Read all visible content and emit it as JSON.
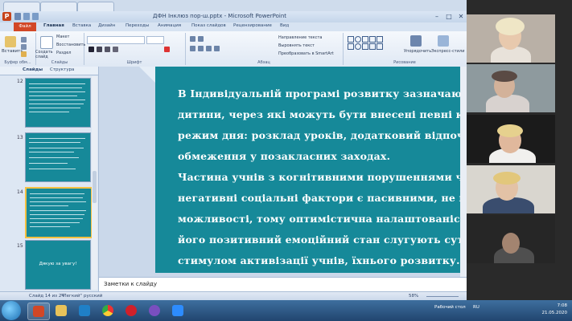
{
  "window": {
    "title": "ДФН Інклюз пор-ш.pptx - Microsoft PowerPoint",
    "app_badge": "P"
  },
  "ribbon": {
    "file_tab": "Файл",
    "tabs": [
      "Главная",
      "Вставка",
      "Дизайн",
      "Переходы",
      "Анимация",
      "Показ слайдов",
      "Рецензирование",
      "Вид"
    ],
    "clipboard": {
      "paste": "Вставить",
      "cut": "Вырезать",
      "copy": "Копировать",
      "format": "Формат по образцу",
      "label": "Буфер обм..."
    },
    "slides": {
      "create": "Создать слайд",
      "layout": "Макет",
      "reset": "Восстановить",
      "section": "Раздел",
      "label": "Слайды"
    },
    "font": {
      "label": "Шрифт"
    },
    "paragraph": {
      "direction": "Направление текста",
      "align": "Выровнять текст",
      "smartart": "Преобразовать в SmartArt",
      "label": "Абзац"
    },
    "drawing": {
      "arrange": "Упорядочить",
      "quick_styles": "Экспресс-стили",
      "label": "Рисование"
    }
  },
  "left_pane": {
    "tabs": [
      "Слайды",
      "Структура"
    ],
    "slides": [
      {
        "number": "12"
      },
      {
        "number": "13"
      },
      {
        "number": "14",
        "selected": true
      },
      {
        "number": "15",
        "text": "Дякую за увагу!"
      }
    ]
  },
  "slide": {
    "lines": [
      "В Індивідуальній програмі розвитку зазначаються потр",
      "дитини, через які можуть бути внесені певні коректи",
      "режим дня: розклад уроків, додатковий відпочи",
      "обмеження у позакласних заходах.",
      "Частина учнів з когнітивними порушеннями ч",
      "негативні соціальні фактори є пасивними, не вірять у",
      "можливості, тому оптимістична налаштованість педа",
      "його позитивний емоційний стан слугують сутте",
      "стимулом активізації учнів, їхнього розвитку."
    ]
  },
  "notes": {
    "placeholder": "Заметки к слайду"
  },
  "status_bar": {
    "slide_counter": "Слайд 14 из 24",
    "theme": "\"Легкий\"",
    "language": "русский",
    "zoom": "58%"
  },
  "taskbar": {
    "tray_text": "Рабочий стол",
    "language": "RU",
    "time": "7:08",
    "date": "21.05.2020"
  },
  "colors": {
    "slide_bg": "#168999",
    "file_tab": "#d24726",
    "selection": "#f6c141"
  }
}
